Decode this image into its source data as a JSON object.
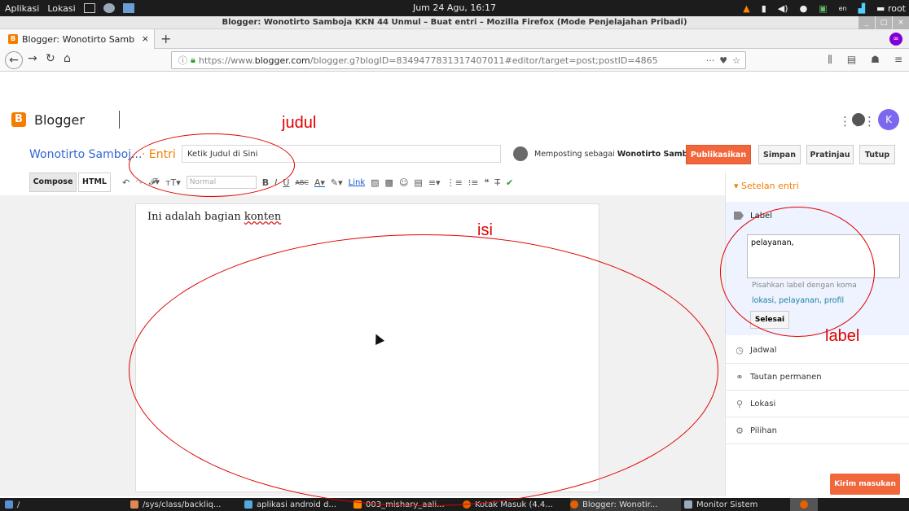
{
  "system_panel": {
    "menu": [
      "Aplikasi",
      "Lokasi"
    ],
    "clock": "Jum 24 Agu, 16:17",
    "lang": "en",
    "user": "root"
  },
  "window": {
    "title": "Blogger: Wonotirto Samboja KKN 44 Unmul – Buat entri – Mozilla Firefox (Mode Penjelajahan Pribadi)"
  },
  "browser": {
    "tab_title": "Blogger: Wonotirto Samb",
    "url_prefix": "https://www.",
    "url_domain": "blogger.com",
    "url_rest": "/blogger.g?blogID=8349477831317407011#editor/target=post;postID=4865",
    "url_actions": "···"
  },
  "blogger": {
    "brand": "Blogger",
    "avatar_letter": "K",
    "blog_title": "Wonotirto Samboj...",
    "breadcrumb": "· Entri",
    "post_title_value": "Ketik Judul di Sini",
    "posting_as_prefix": "Memposting sebagai",
    "posting_as_name": "Wonotirto Samboja",
    "buttons": {
      "publish": "Publikasikan",
      "save": "Simpan",
      "preview": "Pratinjau",
      "close": "Tutup"
    }
  },
  "editor": {
    "mode_compose": "Compose",
    "mode_html": "HTML",
    "font_size": "Normal",
    "link_label": "Link",
    "content_prefix": "Ini adalah bagian ",
    "content_keyword": "konten"
  },
  "sidebar": {
    "header": "Setelan entri",
    "label_title": "Label",
    "label_value": "pelayanan,",
    "hint": "Pisahkan label dengan koma",
    "suggestions": "lokasi, pelayanan, profil",
    "done": "Selesai",
    "items": [
      {
        "label": "Jadwal",
        "icon": "clock-icon"
      },
      {
        "label": "Tautan permanen",
        "icon": "link-icon"
      },
      {
        "label": "Lokasi",
        "icon": "location-pin-icon"
      },
      {
        "label": "Pilihan",
        "icon": "gear-icon"
      }
    ],
    "feedback": "Kirim masukan"
  },
  "annotations": {
    "title": "judul",
    "content": "isi",
    "label": "label",
    "color": "#e00000"
  },
  "taskbar": {
    "path": "/",
    "tasks": [
      "/sys/class/backliq...",
      "aplikasi android d...",
      "003_mishary_aali...",
      "Kotak Masuk (4.4...",
      "Blogger: Wonotir...",
      "Monitor Sistem"
    ]
  },
  "colors": {
    "brand_orange": "#f57d00",
    "publish_red": "#f2663c",
    "link_blue": "#3367d6",
    "annotation_red": "#e00000"
  }
}
